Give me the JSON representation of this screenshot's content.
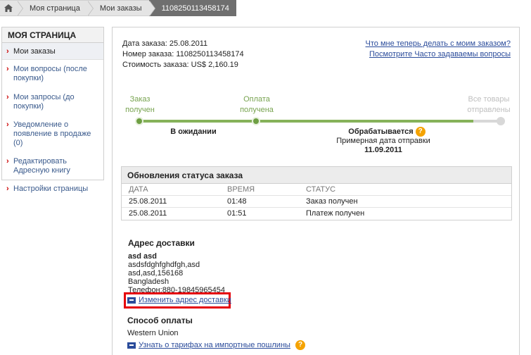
{
  "breadcrumb": {
    "items": [
      "Моя страница",
      "Мои заказы"
    ],
    "current": "1108250113458174"
  },
  "sidebar": {
    "title": "МОЯ СТРАНИЦА",
    "items": [
      {
        "label": "Мои заказы"
      },
      {
        "label": "Мои вопросы (после покупки)"
      },
      {
        "label": "Мои запросы (до покупки)"
      },
      {
        "label": "Уведомление о появление в продаже (0)"
      },
      {
        "label": "Редактировать Адресную книгу"
      },
      {
        "label": "Настройки страницы"
      }
    ]
  },
  "order": {
    "date_label": "Дата заказа:",
    "date": "25.08.2011",
    "number_label": "Номер заказа:",
    "number": "1108250113458174",
    "cost_label": "Стоимость заказа:",
    "cost": "US$ 2,160.19"
  },
  "help": {
    "link1": "Что мне теперь делать с моим заказом?",
    "link2": "Посмотрите Часто задаваемы вопросы"
  },
  "progress": {
    "stage1": "Заказ получен",
    "stage2": "Оплата получена",
    "stage3": "Все товары отправлены",
    "waiting": "В ожидании",
    "processing": "Обрабатывается",
    "eta_label": "Примерная дата отправки",
    "eta_date": "11.09.2011"
  },
  "status": {
    "title": "Обновления статуса заказа",
    "columns": [
      "ДАТА",
      "ВРЕМЯ",
      "СТАТУС"
    ],
    "rows": [
      [
        "25.08.2011",
        "01:48",
        "Заказ получен"
      ],
      [
        "25.08.2011",
        "01:51",
        "Платеж получен"
      ]
    ]
  },
  "address": {
    "title": "Адрес доставки",
    "name": "asd asd",
    "line1": "asdsfdghfghdfgh,asd",
    "line2": "asd,asd,156168",
    "country": "Bangladesh",
    "phone": "Телефон:880-19845965454",
    "edit_link": "Изменить адрес доставки"
  },
  "payment": {
    "title": "Способ оплаты",
    "value": "Western Union",
    "tariff_link": "Узнать о тарифах на импортные пошлины"
  },
  "colors": {
    "accent_green": "#86b25a",
    "link_blue": "#2b4c9b",
    "highlight_red": "#e5000a",
    "help_orange": "#f5a300"
  }
}
